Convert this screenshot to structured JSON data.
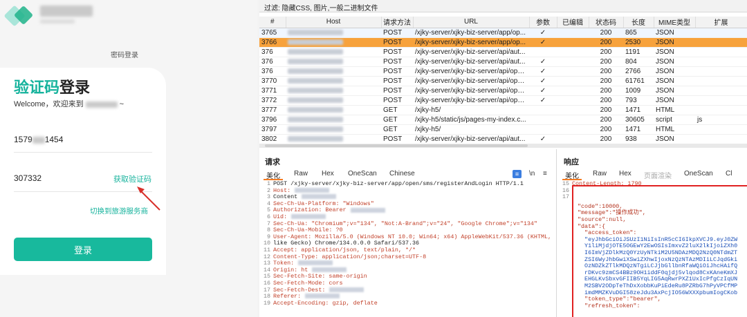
{
  "login": {
    "password_login": "密码登录",
    "title_green": "验证码",
    "title_black": "登录",
    "welcome_prefix": "Welcome，欢迎来到",
    "welcome_suffix": "~",
    "phone_prefix": "1579",
    "phone_suffix": "1454",
    "code_value": "307332",
    "get_code": "获取验证码",
    "switch_link": "切换到旅游服务商",
    "login_button": "登录"
  },
  "devtools": {
    "filter_text": "过滤: 隐藏CSS, 图片,一般二进制文件",
    "columns": [
      "#",
      "Host",
      "请求方法",
      "URL",
      "参数",
      "已编辑",
      "状态码",
      "长度",
      "MIME类型",
      "扩展"
    ],
    "rows": [
      {
        "id": "3765",
        "method": "POST",
        "url": "/xjky-server/xjky-biz-server/app/op...",
        "param": "✓",
        "status": "200",
        "length": "865",
        "mime": "JSON",
        "ext": ""
      },
      {
        "id": "3766",
        "method": "POST",
        "url": "/xjky-server/xjky-biz-server/app/op...",
        "param": "✓",
        "status": "200",
        "length": "2530",
        "mime": "JSON",
        "ext": ""
      },
      {
        "id": "376",
        "method": "POST",
        "url": "/xjky-server/xjky-biz-server/api/aut...",
        "param": "",
        "status": "200",
        "length": "1191",
        "mime": "JSON",
        "ext": ""
      },
      {
        "id": "376",
        "method": "POST",
        "url": "/xjky-server/xjky-biz-server/api/aut...",
        "param": "✓",
        "status": "200",
        "length": "804",
        "mime": "JSON",
        "ext": ""
      },
      {
        "id": "376",
        "method": "POST",
        "url": "/xjky-server/xjky-biz-server/api/ope...",
        "param": "✓",
        "status": "200",
        "length": "2766",
        "mime": "JSON",
        "ext": ""
      },
      {
        "id": "3770",
        "method": "POST",
        "url": "/xjky-server/xjky-biz-server/api/ope...",
        "param": "✓",
        "status": "200",
        "length": "61761",
        "mime": "JSON",
        "ext": ""
      },
      {
        "id": "3771",
        "method": "POST",
        "url": "/xjky-server/xjky-biz-server/api/ope...",
        "param": "✓",
        "status": "200",
        "length": "1009",
        "mime": "JSON",
        "ext": ""
      },
      {
        "id": "3772",
        "method": "POST",
        "url": "/xjky-server/xjky-biz-server/api/ope...",
        "param": "✓",
        "status": "200",
        "length": "793",
        "mime": "JSON",
        "ext": ""
      },
      {
        "id": "3777",
        "method": "GET",
        "url": "/xjky-h5/",
        "param": "",
        "status": "200",
        "length": "1471",
        "mime": "HTML",
        "ext": ""
      },
      {
        "id": "3796",
        "method": "GET",
        "url": "/xjky-h5/static/js/pages-my-index.c...",
        "param": "",
        "status": "200",
        "length": "30605",
        "mime": "script",
        "ext": "js"
      },
      {
        "id": "3797",
        "method": "GET",
        "url": "/xjky-h5/",
        "param": "",
        "status": "200",
        "length": "1471",
        "mime": "HTML",
        "ext": ""
      },
      {
        "id": "3802",
        "method": "POST",
        "url": "/xjky-server/xjky-biz-server/api/aut...",
        "param": "✓",
        "status": "200",
        "length": "938",
        "mime": "JSON",
        "ext": ""
      }
    ],
    "request": {
      "heading": "请求",
      "tabs": [
        "美化",
        "Raw",
        "Hex",
        "OneScan",
        "Chinese"
      ],
      "newline_label": "\\n",
      "lines": [
        "POST /xjky-server/xjky-biz-server/app/open/sms/registerAndLogin HTTP/1.1",
        "Host:",
        "Content",
        "Sec-Ch-Ua-Platform: \"Windows\"",
        "Authorization: Bearer",
        "Uid:",
        "Sec-Ch-Ua: \"Chromium\";v=\"134\", \"Not:A-Brand\";v=\"24\", \"Google Chrome\";v=\"134\"",
        "Sec-Ch-Ua-Mobile: ?0",
        "User-Agent: Mozilla/5.0 (Windows NT 10.0; Win64; x64) AppleWebKit/537.36 (KHTML,",
        "like Gecko) Chrome/134.0.0.0 Safari/537.36",
        "Accept: application/json, text/plain, */*",
        "Content-Type: application/json;charset=UTF-8",
        "Token:",
        "Origin: ht",
        "Sec-Fetch-Site: same-origin",
        "Sec-Fetch-Mode: cors",
        "Sec-Fetch-Dest:",
        "Referer:",
        "Accept-Encoding: gzip, deflate"
      ]
    },
    "response": {
      "heading": "响应",
      "tabs": [
        "美化",
        "Raw",
        "Hex",
        "页面渲染",
        "OneScan",
        "Cl"
      ],
      "line15": "Content-Length: 1790",
      "json_lines": [
        "\"code\":10000,",
        "\"message\":\"操作成功\",",
        "\"source\":null,",
        "\"data\":{",
        "  \"access_token\":",
        "  \"eyJhbGciOiJSUzI1NiIsInR5cCI6IkpXVCJ9.eyJ0ZW",
        "  Y1liMjdjOTE5OGEwY2EwOSIsImxvZ2luX2lkIjoiZXh0",
        "  I6ImVjZDlkMzQ0YzUyNTkiM2U5NDAzMDQ2NzQ0NTdmZT",
        "  ZSI6WyJhbGwiXSwiZXhwIjoxNzQzNTAzMDIiLCJqdGki",
        "  OzNDZkZTlkMDQzNTgiLCJjbGllbnRfaWQiOiJhcHAifQ",
        "  rDKvc9zmCS4BBz9OH1iddF0qjdj5vlqod8CxKAneKmXJ",
        "  EHGLKvSbxvGFIIB5YqLIG5AqRwrPXZ1UxIcPfgCzIqUN",
        "  M2SBV2ODpTeThDxXobbKuPiEdeRu8PZRbG7hPyVPCfMP",
        "  imdMMZKVuDGI58zeJdu3AxPcjIO56WXXXpbumIogCKob",
        "  \"token_type\":\"bearer\",",
        "  \"refresh_token\":"
      ]
    }
  }
}
